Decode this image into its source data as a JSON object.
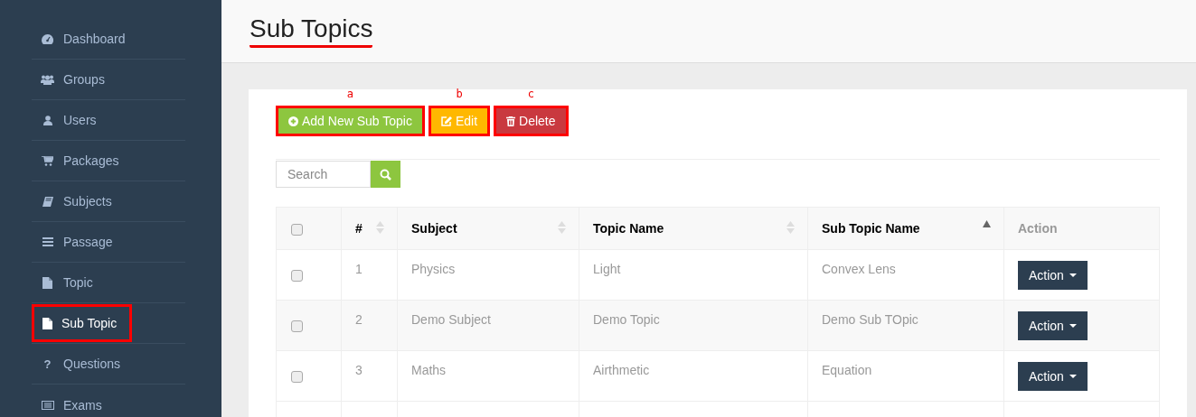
{
  "sidebar": {
    "items": [
      {
        "label": "Dashboard",
        "kind": "gauge",
        "selected": false,
        "annotated": false
      },
      {
        "label": "Groups",
        "kind": "users",
        "selected": false,
        "annotated": false
      },
      {
        "label": "Users",
        "kind": "user",
        "selected": false,
        "annotated": false
      },
      {
        "label": "Packages",
        "kind": "cart",
        "selected": false,
        "annotated": false
      },
      {
        "label": "Subjects",
        "kind": "book",
        "selected": false,
        "annotated": false
      },
      {
        "label": "Passage",
        "kind": "bars",
        "selected": false,
        "annotated": false
      },
      {
        "label": "Topic",
        "kind": "file",
        "selected": false,
        "annotated": false
      },
      {
        "label": "Sub Topic",
        "kind": "file",
        "selected": true,
        "annotated": true
      },
      {
        "label": "Questions",
        "kind": "glyph",
        "glyph": "?",
        "selected": false,
        "annotated": false
      },
      {
        "label": "Exams",
        "kind": "keyboard",
        "selected": false,
        "annotated": false
      }
    ]
  },
  "page": {
    "title": "Sub Topics",
    "title_annotated": true
  },
  "toolbar": {
    "buttons": [
      {
        "kind": "add",
        "label": "Add New Sub Topic",
        "annotation": "a"
      },
      {
        "kind": "edit",
        "label": "Edit",
        "annotation": "b"
      },
      {
        "kind": "delete",
        "label": "Delete",
        "annotation": "c"
      }
    ]
  },
  "search": {
    "placeholder": "Search"
  },
  "table": {
    "header_checked": false,
    "columns": [
      {
        "label": "#",
        "kind": "both"
      },
      {
        "label": "Subject",
        "kind": "both"
      },
      {
        "label": "Topic Name",
        "kind": "both"
      },
      {
        "label": "Sub Topic Name",
        "kind": "asc"
      },
      {
        "label": "Action",
        "kind": "none"
      }
    ],
    "rows": [
      {
        "checked": false,
        "cells": [
          "1",
          "Physics",
          "Light",
          "Convex Lens"
        ],
        "action": "Action"
      },
      {
        "checked": false,
        "cells": [
          "2",
          "Demo Subject",
          "Demo Topic",
          "Demo Sub TOpic"
        ],
        "action": "Action"
      },
      {
        "checked": false,
        "cells": [
          "3",
          "Maths",
          "Airthmetic",
          "Equation"
        ],
        "action": "Action"
      }
    ]
  }
}
